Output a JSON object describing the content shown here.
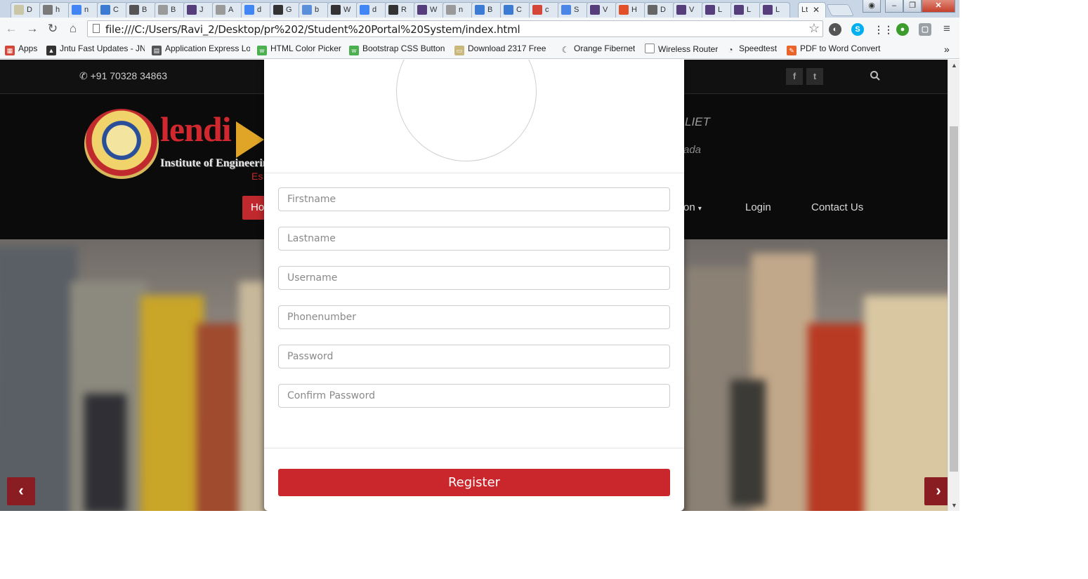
{
  "browser": {
    "tabs": [
      {
        "icon": "folder-icon",
        "title": "D",
        "color": "#c9c7a6"
      },
      {
        "icon": "moon-icon",
        "title": "h",
        "color": "#7a7a7a"
      },
      {
        "icon": "google-icon",
        "title": "n",
        "color": "#4285f4"
      },
      {
        "icon": "code-icon",
        "title": "C",
        "color": "#3b7bd4"
      },
      {
        "icon": "bootstrap-icon",
        "title": "B",
        "color": "#555555"
      },
      {
        "icon": "page-icon",
        "title": "B",
        "color": "#9a9a9a"
      },
      {
        "icon": "bootstrap-icon",
        "title": "J",
        "color": "#563d7c"
      },
      {
        "icon": "page-icon",
        "title": "A",
        "color": "#9a9a9a"
      },
      {
        "icon": "google-icon",
        "title": "d",
        "color": "#4285f4"
      },
      {
        "icon": "github-icon",
        "title": "G",
        "color": "#333333"
      },
      {
        "icon": "chrome-icon",
        "title": "b",
        "color": "#5b8fd9"
      },
      {
        "icon": "github-icon",
        "title": "W",
        "color": "#333333"
      },
      {
        "icon": "google-icon",
        "title": "d",
        "color": "#4285f4"
      },
      {
        "icon": "github-icon",
        "title": "R",
        "color": "#333333"
      },
      {
        "icon": "bootstrap-icon",
        "title": "W",
        "color": "#563d7c"
      },
      {
        "icon": "page-icon",
        "title": "n",
        "color": "#9a9a9a"
      },
      {
        "icon": "code-icon",
        "title": "B",
        "color": "#3b7bd4"
      },
      {
        "icon": "code-icon",
        "title": "C",
        "color": "#3b7bd4"
      },
      {
        "icon": "gmail-icon",
        "title": "c",
        "color": "#d44638"
      },
      {
        "icon": "doc-icon",
        "title": "S",
        "color": "#4a86e8"
      },
      {
        "icon": "bootstrap-icon",
        "title": "V",
        "color": "#563d7c"
      },
      {
        "icon": "joomla-icon",
        "title": "H",
        "color": "#e34f26"
      },
      {
        "icon": "download-icon",
        "title": "D",
        "color": "#666666"
      },
      {
        "icon": "bootstrap-icon",
        "title": "V",
        "color": "#563d7c"
      },
      {
        "icon": "bootstrap-icon",
        "title": "L",
        "color": "#563d7c"
      },
      {
        "icon": "bootstrap-icon",
        "title": "L",
        "color": "#563d7c"
      },
      {
        "icon": "bootstrap-icon",
        "title": "L",
        "color": "#563d7c"
      }
    ],
    "active_tab_title": "Lt",
    "url": "file:///C:/Users/Ravi_2/Desktop/pr%202/Student%20Portal%20System/index.html",
    "bookmarks": [
      {
        "label": "Apps",
        "icon": "apps-grid-icon",
        "color": "#d44638"
      },
      {
        "label": "Jntu Fast Updates - JN",
        "icon": "graduation-cap-icon",
        "color": "#333333"
      },
      {
        "label": "Application Express Lo",
        "icon": "chart-icon",
        "color": "#444444"
      },
      {
        "label": "HTML Color Picker",
        "icon": "w3-icon",
        "color": "#4caf50"
      },
      {
        "label": "Bootstrap CSS Button",
        "icon": "w3-icon",
        "color": "#4caf50"
      },
      {
        "label": "Download 2317 Free",
        "icon": "folder-icon",
        "color": "#c9b87a"
      },
      {
        "label": "Orange Fibernet",
        "icon": "moon-icon",
        "color": "#555555"
      },
      {
        "label": "Wireless Router",
        "icon": "page-icon",
        "color": "#999999"
      },
      {
        "label": "Speedtest",
        "icon": "speedometer-icon",
        "color": "#333333"
      },
      {
        "label": "PDF to Word Convert",
        "icon": "pdf-icon",
        "color": "#e8642a"
      }
    ],
    "bookmarks_overflow": "»"
  },
  "site": {
    "phone": "+91 70328 34863",
    "logo_word": "lendi",
    "logo_sub": "Institute of Engineerin",
    "logo_est": "Es",
    "header_right_1": "LIET",
    "header_right_2": "ada",
    "nav": {
      "home": "Ho",
      "dropdown_item": "on",
      "login": "Login",
      "contact": "Contact Us"
    },
    "social": {
      "facebook": "f",
      "twitter": "t"
    }
  },
  "modal": {
    "fields": [
      {
        "name": "firstname",
        "placeholder": "Firstname",
        "type": "text"
      },
      {
        "name": "lastname",
        "placeholder": "Lastname",
        "type": "text"
      },
      {
        "name": "username",
        "placeholder": "Username",
        "type": "text"
      },
      {
        "name": "phonenumber",
        "placeholder": "Phonenumber",
        "type": "text"
      },
      {
        "name": "password",
        "placeholder": "Password",
        "type": "password"
      },
      {
        "name": "confirm-password",
        "placeholder": "Confirm Password",
        "type": "password"
      }
    ],
    "register_label": "Register"
  },
  "colors": {
    "accent": "#c9272c",
    "top_bar": "#111111",
    "modal_bg": "#ffffff"
  }
}
